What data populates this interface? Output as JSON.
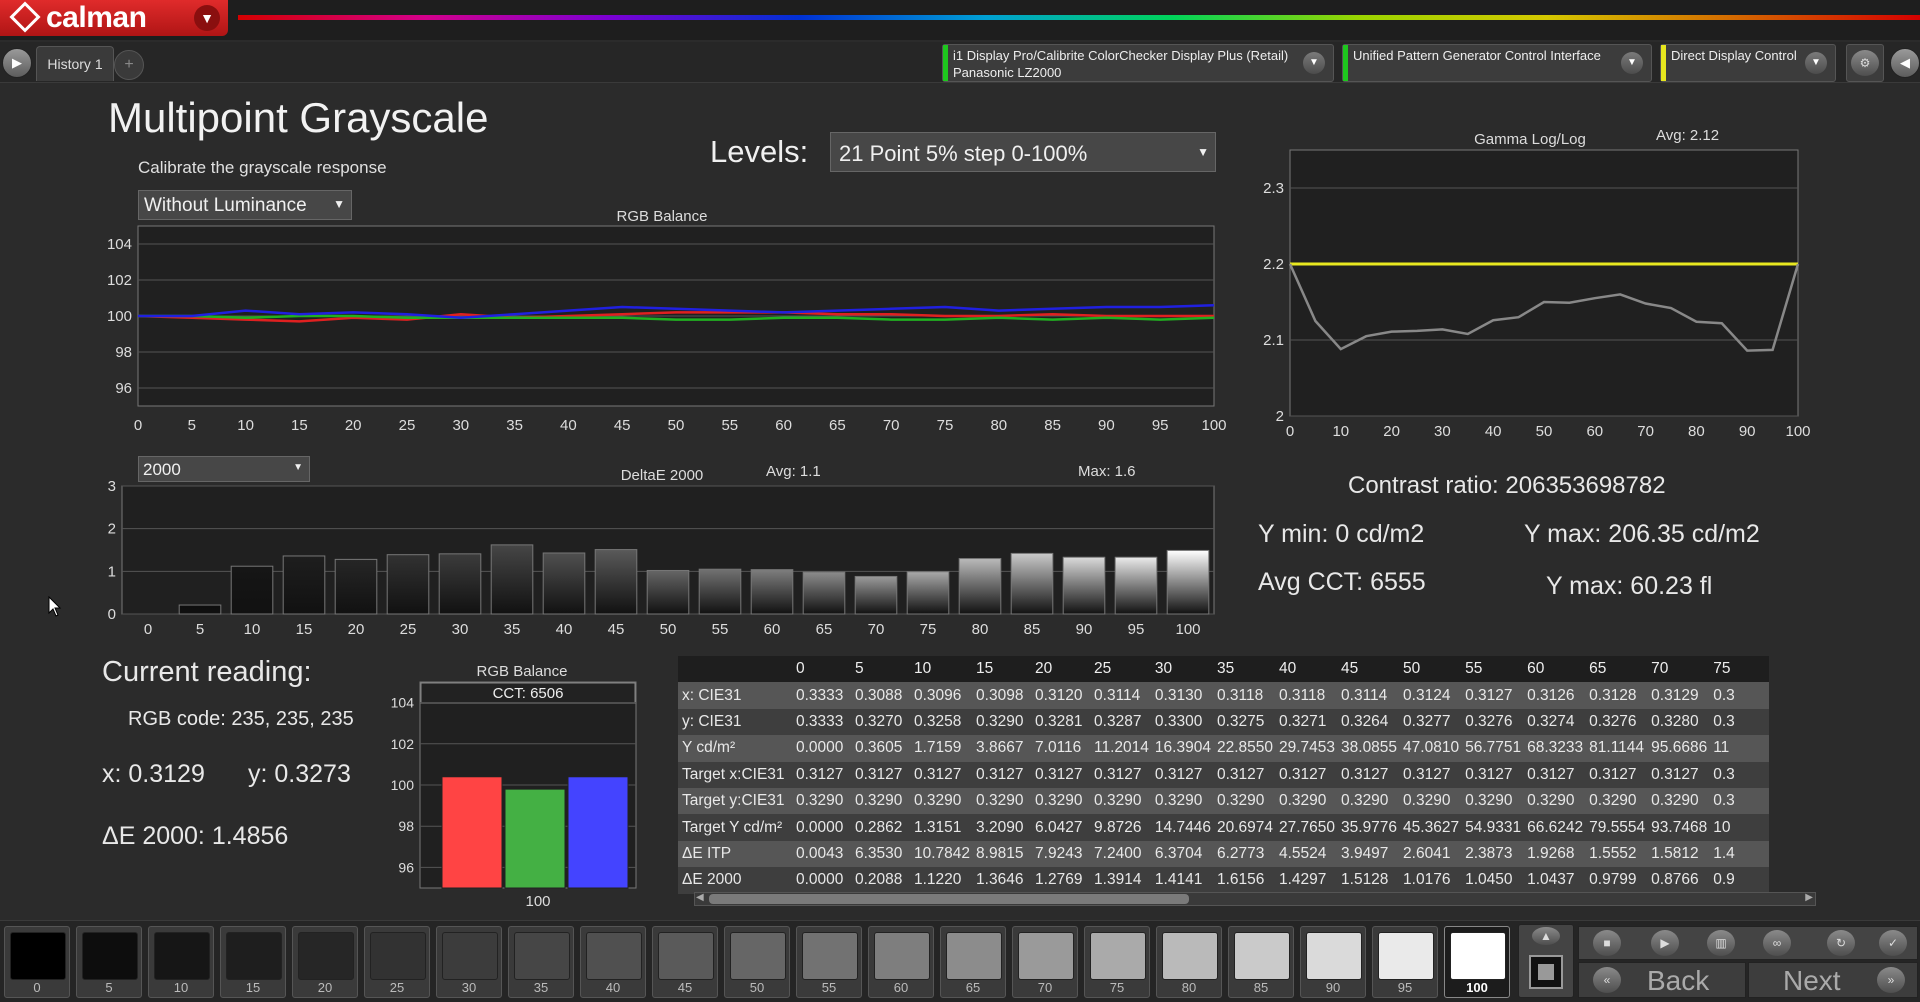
{
  "app": {
    "logo_text": "calman"
  },
  "tabs": {
    "history": "History 1",
    "add": "+"
  },
  "devices": [
    {
      "line1": "i1 Display Pro/Calibrite ColorChecker Display Plus (Retail)",
      "line2": "Panasonic LZ2000",
      "color": "#1ec81e"
    },
    {
      "line1": "Unified Pattern Generator Control Interface",
      "line2": "",
      "color": "#1ec81e"
    },
    {
      "line1": "Direct Display Control",
      "line2": "",
      "color": "#e6e61e"
    }
  ],
  "page": {
    "title": "Multipoint Grayscale",
    "subtitle": "Calibrate the grayscale response",
    "luminance_mode": "Without Luminance",
    "levels_label": "Levels:",
    "levels_value": "21 Point 5% step 0-100%",
    "delta_select": "2000"
  },
  "summary": {
    "contrast": "Contrast ratio: 206353698782",
    "ymin": "Y min: 0 cd/m2",
    "ymax": "Y max: 206.35 cd/m2",
    "cct": "Avg CCT: 6555",
    "ymax_fl": "Y max: 60.23 fl"
  },
  "current": {
    "heading": "Current reading:",
    "rgb": "RGB code: 235, 235, 235",
    "x": "x: 0.3129",
    "y": "y: 0.3273",
    "de": "ΔE 2000: 1.4856"
  },
  "chart_data": [
    {
      "type": "line",
      "title": "RGB Balance",
      "x": [
        0,
        5,
        10,
        15,
        20,
        25,
        30,
        35,
        40,
        45,
        50,
        55,
        60,
        65,
        70,
        75,
        80,
        85,
        90,
        95,
        100
      ],
      "ylim": [
        95,
        105
      ],
      "yticks": [
        96,
        98,
        100,
        102,
        104
      ],
      "series": [
        {
          "name": "Red",
          "color": "#e02020",
          "values": [
            100,
            99.9,
            99.8,
            99.7,
            99.9,
            99.8,
            100.1,
            99.9,
            100,
            100.1,
            100.2,
            100.2,
            100.2,
            100.1,
            100.1,
            100,
            100,
            100.1,
            100,
            100,
            100
          ]
        },
        {
          "name": "Green",
          "color": "#20b020",
          "values": [
            100,
            100,
            99.9,
            100,
            100,
            99.9,
            99.9,
            99.9,
            99.9,
            99.9,
            99.8,
            99.8,
            99.9,
            99.9,
            99.8,
            99.8,
            99.9,
            99.8,
            99.9,
            99.8,
            99.9
          ]
        },
        {
          "name": "Blue",
          "color": "#2020e0",
          "values": [
            100,
            100,
            100.3,
            100.1,
            100.2,
            100.1,
            99.9,
            100.1,
            100.3,
            100.5,
            100.4,
            100.3,
            100.2,
            100.3,
            100.4,
            100.5,
            100.3,
            100.4,
            100.5,
            100.5,
            100.6
          ]
        }
      ]
    },
    {
      "type": "bar",
      "title": "DeltaE 2000",
      "avg_label": "Avg: 1.1",
      "max_label": "Max: 1.6",
      "categories": [
        "0",
        "5",
        "10",
        "15",
        "20",
        "25",
        "30",
        "35",
        "40",
        "45",
        "50",
        "55",
        "60",
        "65",
        "70",
        "75",
        "80",
        "85",
        "90",
        "95",
        "100"
      ],
      "values": [
        0.0,
        0.21,
        1.12,
        1.36,
        1.28,
        1.39,
        1.41,
        1.62,
        1.43,
        1.51,
        1.02,
        1.05,
        1.04,
        0.98,
        0.88,
        0.99,
        1.3,
        1.42,
        1.33,
        1.33,
        1.49
      ],
      "ylim": [
        0,
        3
      ],
      "yticks": [
        0,
        1,
        2,
        3
      ]
    },
    {
      "type": "line",
      "title": "Gamma Log/Log",
      "avg_label": "Avg: 2.12",
      "x": [
        0,
        5,
        10,
        15,
        20,
        25,
        30,
        35,
        40,
        45,
        50,
        55,
        60,
        65,
        70,
        75,
        80,
        85,
        90,
        95,
        100
      ],
      "xticks": [
        0,
        10,
        20,
        30,
        40,
        50,
        60,
        70,
        80,
        90,
        100
      ],
      "ylim": [
        2.0,
        2.35
      ],
      "yticks": [
        2,
        2.1,
        2.2,
        2.3
      ],
      "target": 2.2,
      "series": [
        {
          "name": "Gamma",
          "color": "#888888",
          "values": [
            2.2,
            2.125,
            2.088,
            2.105,
            2.111,
            2.112,
            2.114,
            2.108,
            2.126,
            2.13,
            2.15,
            2.149,
            2.155,
            2.16,
            2.148,
            2.142,
            2.124,
            2.122,
            2.086,
            2.087,
            2.2
          ]
        }
      ]
    },
    {
      "type": "bar",
      "title": "RGB Balance",
      "cct_label": "CCT: 6506",
      "categories": [
        "100"
      ],
      "ylim": [
        95,
        105
      ],
      "yticks": [
        96,
        98,
        100,
        102,
        104
      ],
      "series": [
        {
          "name": "Red",
          "color": "#ff4444",
          "values": [
            100.4
          ]
        },
        {
          "name": "Green",
          "color": "#44b044",
          "values": [
            99.8
          ]
        },
        {
          "name": "Blue",
          "color": "#4444ff",
          "values": [
            100.4
          ]
        }
      ]
    }
  ],
  "table": {
    "columns": [
      "0",
      "5",
      "10",
      "15",
      "20",
      "25",
      "30",
      "35",
      "40",
      "45",
      "50",
      "55",
      "60",
      "65",
      "70",
      "75"
    ],
    "rows": [
      {
        "label": "x: CIE31",
        "values": [
          "0.3333",
          "0.3088",
          "0.3096",
          "0.3098",
          "0.3120",
          "0.3114",
          "0.3130",
          "0.3118",
          "0.3118",
          "0.3114",
          "0.3124",
          "0.3127",
          "0.3126",
          "0.3128",
          "0.3129",
          "0.3"
        ]
      },
      {
        "label": "y: CIE31",
        "values": [
          "0.3333",
          "0.3270",
          "0.3258",
          "0.3290",
          "0.3281",
          "0.3287",
          "0.3300",
          "0.3275",
          "0.3271",
          "0.3264",
          "0.3277",
          "0.3276",
          "0.3274",
          "0.3276",
          "0.3280",
          "0.3"
        ]
      },
      {
        "label": "Y cd/m²",
        "values": [
          "0.0000",
          "0.3605",
          "1.7159",
          "3.8667",
          "7.0116",
          "11.2014",
          "16.3904",
          "22.8550",
          "29.7453",
          "38.0855",
          "47.0810",
          "56.7751",
          "68.3233",
          "81.1144",
          "95.6686",
          "11"
        ]
      },
      {
        "label": "Target x:CIE31",
        "values": [
          "0.3127",
          "0.3127",
          "0.3127",
          "0.3127",
          "0.3127",
          "0.3127",
          "0.3127",
          "0.3127",
          "0.3127",
          "0.3127",
          "0.3127",
          "0.3127",
          "0.3127",
          "0.3127",
          "0.3127",
          "0.3"
        ]
      },
      {
        "label": "Target y:CIE31",
        "values": [
          "0.3290",
          "0.3290",
          "0.3290",
          "0.3290",
          "0.3290",
          "0.3290",
          "0.3290",
          "0.3290",
          "0.3290",
          "0.3290",
          "0.3290",
          "0.3290",
          "0.3290",
          "0.3290",
          "0.3290",
          "0.3"
        ]
      },
      {
        "label": "Target Y cd/m²",
        "values": [
          "0.0000",
          "0.2862",
          "1.3151",
          "3.2090",
          "6.0427",
          "9.8726",
          "14.7446",
          "20.6974",
          "27.7650",
          "35.9776",
          "45.3627",
          "54.9331",
          "66.6242",
          "79.5554",
          "93.7468",
          "10"
        ]
      },
      {
        "label": "ΔE ITP",
        "values": [
          "0.0043",
          "6.3530",
          "10.7842",
          "8.9815",
          "7.9243",
          "7.2400",
          "6.3704",
          "6.2773",
          "4.5524",
          "3.9497",
          "2.6041",
          "2.3873",
          "1.9268",
          "1.5552",
          "1.5812",
          "1.4"
        ]
      },
      {
        "label": "ΔE 2000",
        "values": [
          "0.0000",
          "0.2088",
          "1.1220",
          "1.3646",
          "1.2769",
          "1.3914",
          "1.4141",
          "1.6156",
          "1.4297",
          "1.5128",
          "1.0176",
          "1.0450",
          "1.0437",
          "0.9799",
          "0.8766",
          "0.9"
        ]
      }
    ]
  },
  "swatches": [
    {
      "label": "0",
      "color": "#000000"
    },
    {
      "label": "5",
      "color": "#0d0d0d"
    },
    {
      "label": "10",
      "color": "#161616"
    },
    {
      "label": "15",
      "color": "#1e1e1e"
    },
    {
      "label": "20",
      "color": "#262626"
    },
    {
      "label": "25",
      "color": "#323232"
    },
    {
      "label": "30",
      "color": "#3c3c3c"
    },
    {
      "label": "35",
      "color": "#464646"
    },
    {
      "label": "40",
      "color": "#505050"
    },
    {
      "label": "45",
      "color": "#5a5a5a"
    },
    {
      "label": "50",
      "color": "#666666"
    },
    {
      "label": "55",
      "color": "#727272"
    },
    {
      "label": "60",
      "color": "#7e7e7e"
    },
    {
      "label": "65",
      "color": "#8c8c8c"
    },
    {
      "label": "70",
      "color": "#9a9a9a"
    },
    {
      "label": "75",
      "color": "#aaaaaa"
    },
    {
      "label": "80",
      "color": "#bababa"
    },
    {
      "label": "85",
      "color": "#cacaca"
    },
    {
      "label": "90",
      "color": "#dadada"
    },
    {
      "label": "95",
      "color": "#eaeaea"
    },
    {
      "label": "100",
      "color": "#ffffff"
    }
  ],
  "nav": {
    "back": "Back",
    "next": "Next"
  }
}
